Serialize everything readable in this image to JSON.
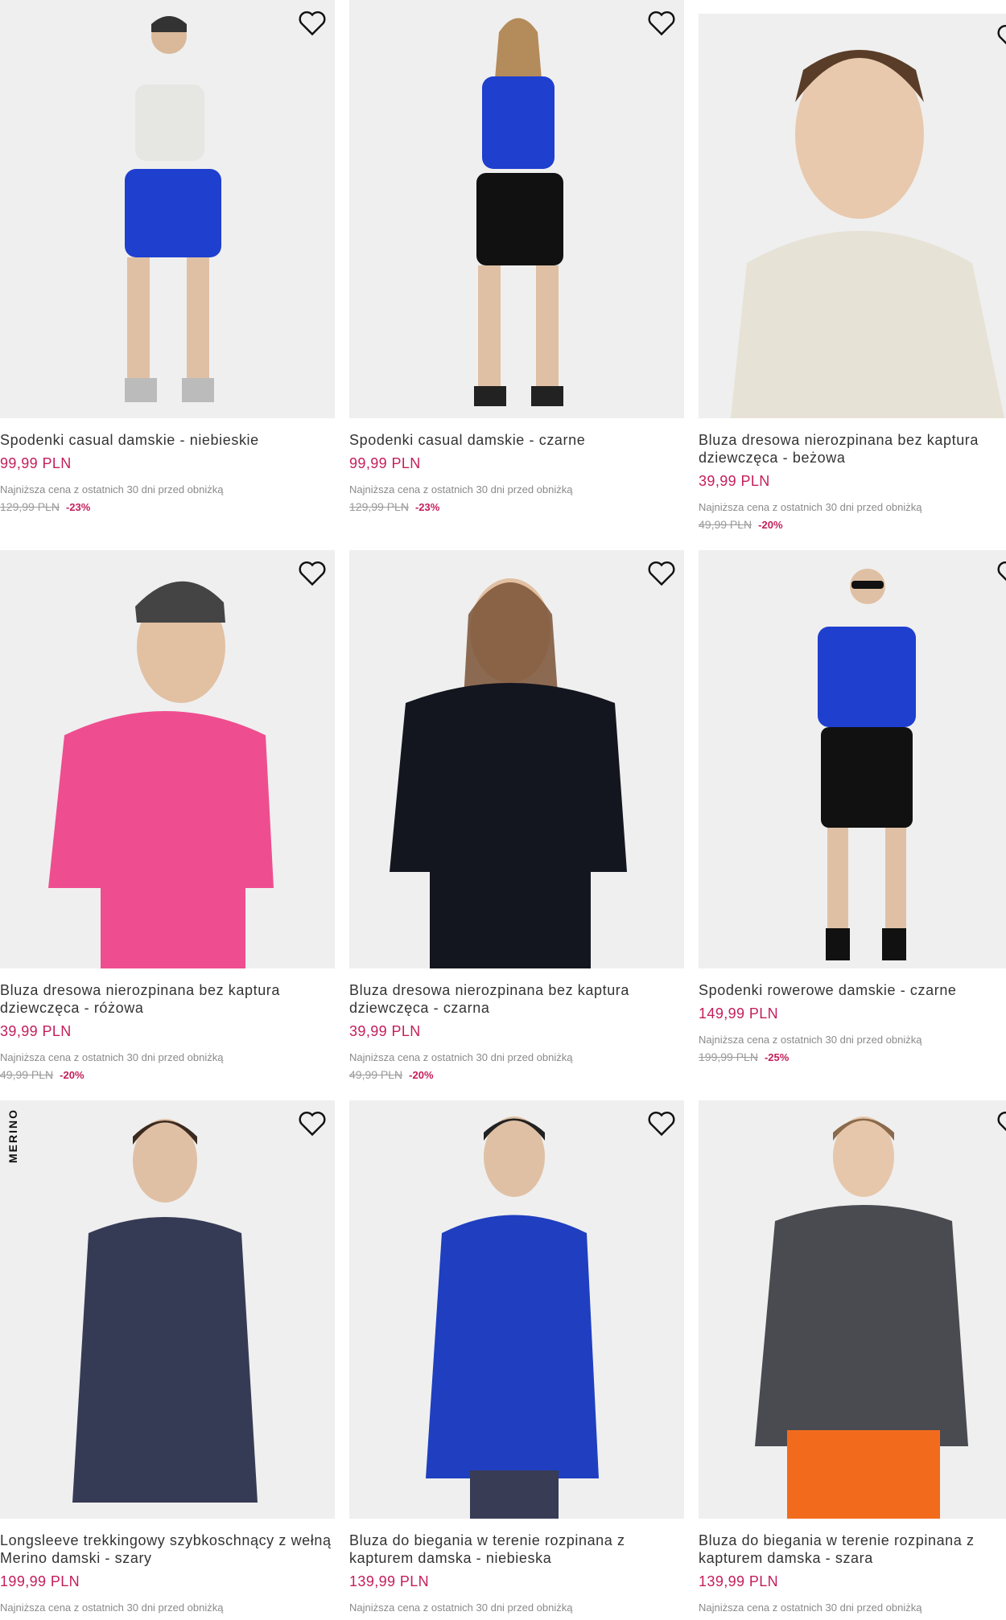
{
  "lowest_label": "Najniższa cena z ostatnich 30 dni przed obniżką",
  "products": [
    {
      "title": "Spodenki casual damskie - niebieskie",
      "price": "99,99 PLN",
      "old_price": "129,99 PLN",
      "discount": "-23%"
    },
    {
      "title": "Spodenki casual damskie - czarne",
      "price": "99,99 PLN",
      "old_price": "129,99 PLN",
      "discount": "-23%"
    },
    {
      "title": "Bluza dresowa nierozpinana bez kaptura dziewczęca - beżowa",
      "price": "39,99 PLN",
      "old_price": "49,99 PLN",
      "discount": "-20%"
    },
    {
      "title": "Bluza dresowa nierozpinana bez kaptura dziewczęca - różowa",
      "price": "39,99 PLN",
      "old_price": "49,99 PLN",
      "discount": "-20%"
    },
    {
      "title": "Bluza dresowa nierozpinana bez kaptura dziewczęca - czarna",
      "price": "39,99 PLN",
      "old_price": "49,99 PLN",
      "discount": "-20%"
    },
    {
      "title": "Spodenki rowerowe damskie - czarne",
      "price": "149,99 PLN",
      "old_price": "199,99 PLN",
      "discount": "-25%"
    },
    {
      "title": "Longsleeve trekkingowy szybkoschnący z wełną Merino damski - szary",
      "price": "199,99 PLN",
      "badge": "MERINO"
    },
    {
      "title": "Bluza do biegania w terenie rozpinana z kapturem damska - niebieska",
      "price": "139,99 PLN"
    },
    {
      "title": "Bluza do biegania w terenie rozpinana z kapturem damska - szara",
      "price": "139,99 PLN"
    }
  ],
  "colors": {
    "price": "#c41e5a",
    "image_bg": "#efefef"
  },
  "icons": {
    "wishlist": "heart-outline-icon"
  }
}
